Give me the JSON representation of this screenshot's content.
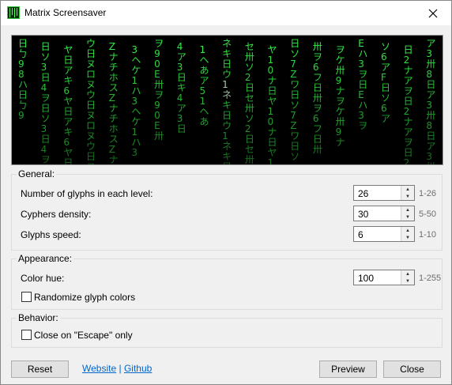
{
  "window": {
    "title": "Matrix Screensaver"
  },
  "preview": {
    "glyph_color": "#33ee44",
    "highlight_color": "#ccffcc",
    "columns": [
      "日ㄅ98ハ",
      "ヲ日ソ3日4",
      "キ6ヤ日ア",
      "ヌロヌウ日",
      "ナチホスZ",
      "3ヘケ1ハ",
      "卅ヲ90E",
      "日キ4ア3",
      "あア51ヘ",
      "キ日ウ1ネ",
      "セ卅ソ2日",
      "日ヤ10ナ",
      "Zワ日ソ7",
      "6フ日卅ヲ",
      "ケ卅9ナヲ",
      "Eハ3ヲ日",
      "日ソ6アF",
      "アヲ日2ナ",
      "卅8日ア3"
    ]
  },
  "general": {
    "title": "General:",
    "rows": [
      {
        "label": "Number of glyphs in each level:",
        "value": "26",
        "range": "1-26"
      },
      {
        "label": "Cyphers density:",
        "value": "30",
        "range": "5-50"
      },
      {
        "label": "Glyphs speed:",
        "value": "6",
        "range": "1-10"
      }
    ]
  },
  "appearance": {
    "title": "Appearance:",
    "hue_label": "Color hue:",
    "hue_value": "100",
    "hue_range": "1-255",
    "randomize_label": "Randomize glyph colors",
    "randomize_checked": false
  },
  "behavior": {
    "title": "Behavior:",
    "escape_label": "Close on \"Escape\" only",
    "escape_checked": false
  },
  "footer": {
    "reset": "Reset",
    "website": "Website",
    "separator": "|",
    "github": "Github",
    "preview": "Preview",
    "close": "Close"
  }
}
